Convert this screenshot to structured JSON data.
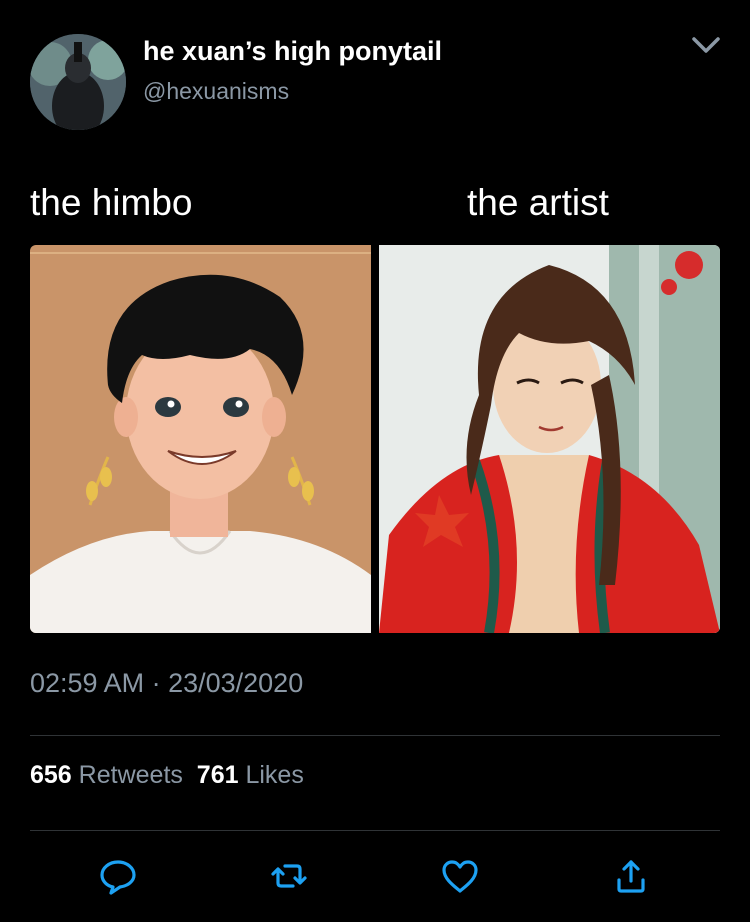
{
  "tweet": {
    "author_name": "he xuan’s high ponytail",
    "author_handle": "@hexuanisms",
    "caption_left": "the himbo",
    "caption_right": "the artist",
    "timestamp": "02:59 AM · 23/03/2020",
    "retweets": "656",
    "retweets_label": "Retweets",
    "likes": "761",
    "likes_label": "Likes"
  },
  "icons": {
    "menu": "chevron-down-icon",
    "reply": "reply-icon",
    "retweet": "retweet-icon",
    "like": "heart-icon",
    "share": "share-icon"
  },
  "colors": {
    "background": "#000000",
    "primary_text": "#ffffff",
    "secondary_text": "#8b98a5",
    "divider": "#2f3336",
    "icon": "#1da1f2"
  }
}
